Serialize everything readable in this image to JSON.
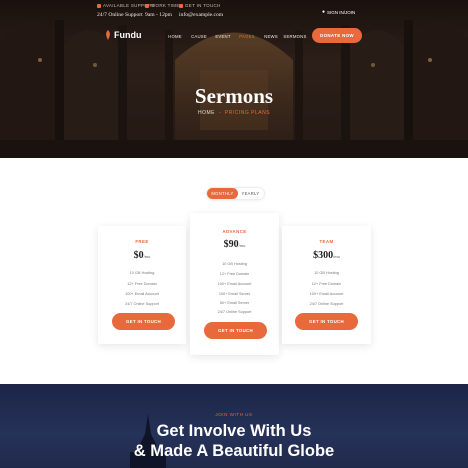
{
  "topbar": {
    "support_label": "Available Support",
    "support_value": "24/7 Online Support",
    "work_label": "Work Time",
    "work_value": "9am - 12pm",
    "mail_label": "Get in touch",
    "mail_value": "info@example.com",
    "login_label": "Sign in/Join"
  },
  "brand": {
    "name": "Fundu",
    "accent": "#e8693b"
  },
  "nav": {
    "items": [
      "Home",
      "Cause",
      "Event",
      "Pages",
      "News",
      "Sermons"
    ],
    "active_index": 3,
    "donate_label": "Donate Now"
  },
  "hero": {
    "title": "Sermons",
    "breadcrumb_home": "Home",
    "breadcrumb_sep": "-",
    "breadcrumb_current": "Pricing Plans"
  },
  "billing_toggle": {
    "options": [
      "Monthly",
      "Yearly"
    ],
    "selected": "Monthly"
  },
  "plans": [
    {
      "name": "Free",
      "price": "$0",
      "period": "/mo",
      "features": [
        "10 GB Hosting",
        "12+ Free Domain",
        "100+ Email Account",
        "24/7 Online Support"
      ],
      "button": "Get In Touch"
    },
    {
      "name": "Advance",
      "price": "$90",
      "period": "/mo",
      "features": [
        "10 GB Hosting",
        "12+ Free Domain",
        "100+ Email Account",
        "100+ Email Server",
        "50+ Email Server",
        "24/7 Online Support"
      ],
      "button": "Get In Touch"
    },
    {
      "name": "Team",
      "price": "$300",
      "period": "/mo",
      "features": [
        "10 GB Hosting",
        "12+ Free Domain",
        "100+ Email Account",
        "24/7 Online Support"
      ],
      "button": "Get In Touch"
    }
  ],
  "cta": {
    "kicker": "Join With Us",
    "line1": "Get Involve With Us",
    "line2": "& Made A Beautiful Globe"
  }
}
